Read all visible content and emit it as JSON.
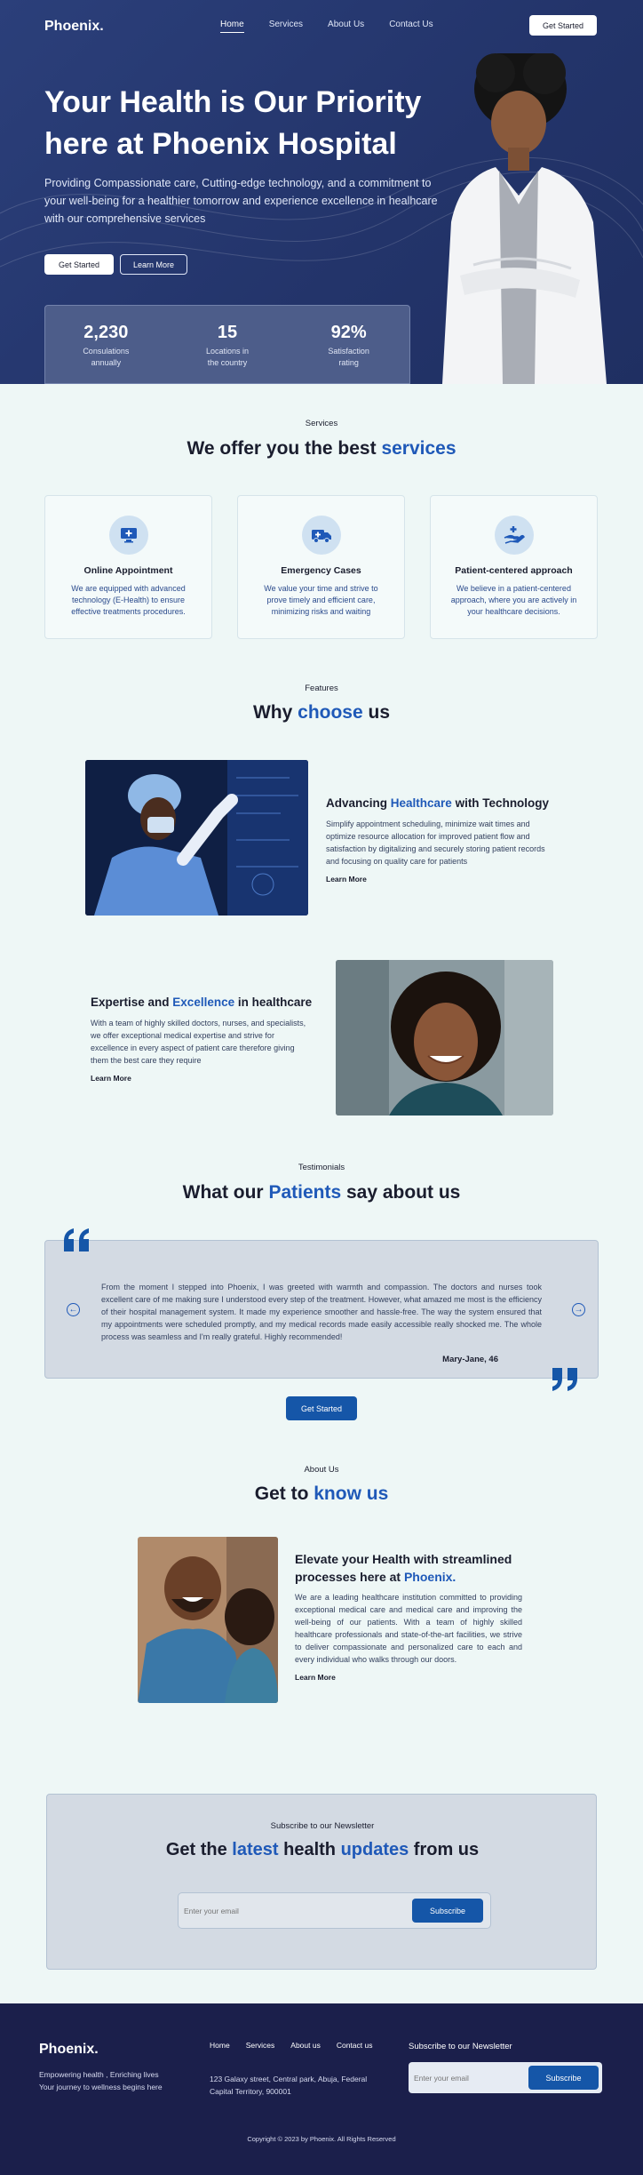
{
  "header": {
    "logo": "Phoenix.",
    "nav": [
      "Home",
      "Services",
      "About Us",
      "Contact Us"
    ],
    "cta": "Get Started"
  },
  "hero": {
    "title": "Your Health is Our Priority here at Phoenix Hospital",
    "subtitle": "Providing Compassionate care, Cutting-edge technology, and a commitment to your well-being for a healthier tomorrow and experience excellence in healhcare with our comprehensive services",
    "primary_button": "Get Started",
    "secondary_button": "Learn More",
    "stats": [
      {
        "value": "2,230",
        "label": "Consulations annually"
      },
      {
        "value": "15",
        "label": "Locations in the country"
      },
      {
        "value": "92%",
        "label": "Satisfaction rating"
      }
    ]
  },
  "services": {
    "tag": "Services",
    "title_plain": "We offer you the best ",
    "title_accent": "services",
    "cards": [
      {
        "icon": "monitor-plus-icon",
        "title": "Online Appointment",
        "text": "We are equipped with advanced technology (E-Health) to ensure effective treatments procedures."
      },
      {
        "icon": "ambulance-icon",
        "title": "Emergency Cases",
        "text": "We value your time and strive to prove timely and efficient care, minimizing risks and waiting"
      },
      {
        "icon": "hand-care-icon",
        "title": "Patient-centered approach",
        "text": "We believe in a patient-centered approach, where you are actively in your healthcare decisions."
      }
    ]
  },
  "features": {
    "tag": "Features",
    "title_plain1": "Why ",
    "title_accent": "choose",
    "title_plain2": " us",
    "items": [
      {
        "t1": "Advancing ",
        "accent": "Healthcare",
        "t2": " with Technology",
        "text": "Simplify appointment scheduling, minimize wait times and optimize resource allocation for improved patient flow and satisfaction by digitalizing and securely storing patient records and focusing on quality care for patients",
        "link": "Learn More"
      },
      {
        "t1": "Expertise and ",
        "accent": "Excellence",
        "t2": " in healthcare",
        "text": "With a team of highly skilled doctors, nurses, and specialists, we offer exceptional medical expertise and strive for excellence in every aspect of patient care therefore giving them the best care they require",
        "link": "Learn More"
      }
    ]
  },
  "testimonials": {
    "tag": "Testimonials",
    "title_plain1": "What our ",
    "title_accent": "Patients",
    "title_plain2": " say about us",
    "quote": "From the moment I stepped into Phoenix, I was greeted with warmth and compassion. The doctors and nurses took excellent  care of me making sure I understood every step of the treatment. However, what amazed me most is the efficiency of their hospital management system. It made my experience smoother and hassle-free. The way the system ensured that my appointments were scheduled promptly, and my medical records made easily accessible really shocked me. The whole process was seamless and I'm really grateful. Highly recommended!",
    "author": "Mary-Jane, 46",
    "button": "Get Started"
  },
  "about": {
    "tag": "About Us",
    "title_plain": "Get to ",
    "title_accent": "know us",
    "heading_plain": "Elevate your Health with streamlined processes here at ",
    "heading_accent": "Phoenix.",
    "text": "We are a leading healthcare institution committed to providing exceptional medical care and medical care and improving the well-being of our patients. With a team of highly skilled healthcare professionals and state-of-the-art facilities, we strive to deliver compassionate and personalized care to each and every individual who walks through our doors.",
    "link": "Learn More"
  },
  "newsletter": {
    "tag": "Subscribe to our Newsletter",
    "t1": "Get the ",
    "a1": "latest",
    "t2": " health ",
    "a2": "updates",
    "t3": " from us",
    "placeholder": "Enter your email",
    "button": "Subscribe"
  },
  "footer": {
    "logo": "Phoenix.",
    "tagline1": "Empowering health , Enriching lives",
    "tagline2": "Your journey to wellness begins here",
    "nav": [
      "Home",
      "Services",
      "About us",
      "Contact us"
    ],
    "address1": "123 Galaxy street, Central park, Abuja, Federal",
    "address2": "Capital Territory, 900001",
    "newsletter_title": "Subscribe to our Newsletter",
    "placeholder": "Enter your email",
    "button": "Subscribe",
    "copyright": "Copyright © 2023 by Phoenix. All Rights Reserved"
  }
}
